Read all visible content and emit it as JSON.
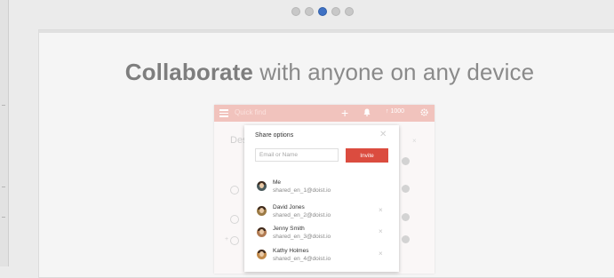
{
  "carousel": {
    "dot_count": 5,
    "active_index": 2
  },
  "headline": {
    "strong": "Collaborate",
    "rest": " with anyone on any device"
  },
  "app": {
    "search_placeholder": "Quick find",
    "karma_text": "↑ 1000",
    "section_label": "Des"
  },
  "share": {
    "title": "Share options",
    "close_glyph": "✕",
    "email_placeholder": "Email or Name",
    "invite_label": "Invite",
    "members": [
      {
        "name": "Me",
        "email": "shared_en_1@doist.io",
        "removable": false,
        "avatar_color": "#4a5a5c"
      },
      {
        "name": "David Jones",
        "email": "shared_en_2@doist.io",
        "removable": true,
        "avatar_color": "#9b7a45"
      },
      {
        "name": "Jenny Smith",
        "email": "shared_en_3@doist.io",
        "removable": true,
        "avatar_color": "#b07a52"
      },
      {
        "name": "Kathy Holmes",
        "email": "shared_en_4@doist.io",
        "removable": true,
        "avatar_color": "#c18a4a"
      }
    ],
    "remove_glyph": "×"
  },
  "colors": {
    "accent_red": "#db4c3f",
    "active_dot": "#3f71c4",
    "app_bar": "#f1c3bd"
  }
}
